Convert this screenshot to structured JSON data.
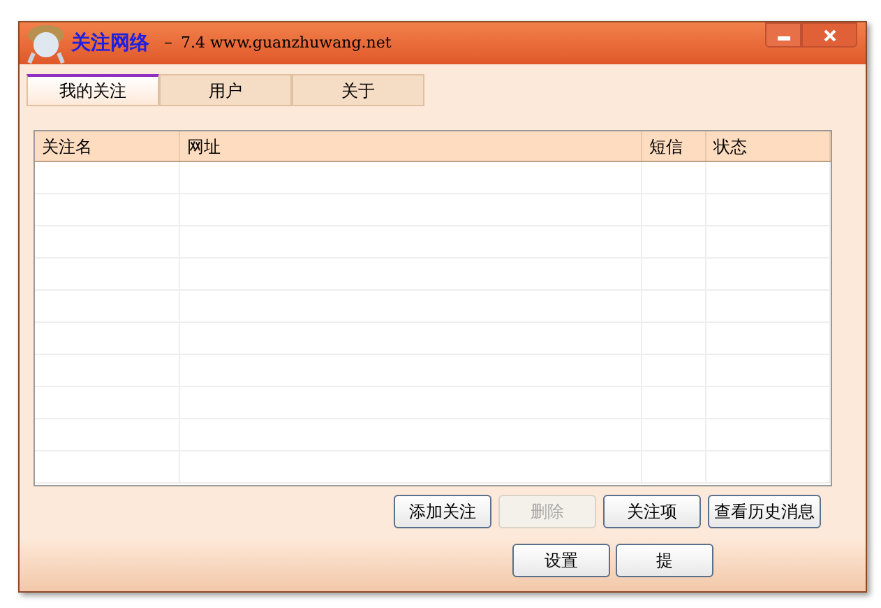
{
  "window": {
    "title": "关注网络",
    "subtitle": "－ 7.4 www.guanzhuwang.net"
  },
  "tabs": [
    {
      "label": "我的关注",
      "selected": true
    },
    {
      "label": "用户",
      "selected": false
    },
    {
      "label": "关于",
      "selected": false
    }
  ],
  "table": {
    "columns": [
      "关注名",
      "网址",
      "短信",
      "状态"
    ]
  },
  "buttons": [
    {
      "label": "添加关注",
      "disabled": false
    },
    {
      "label": "删除",
      "disabled": true
    },
    {
      "label": "关注项",
      "disabled": false
    },
    {
      "label": "查看历史消息",
      "disabled": false
    }
  ],
  "footer_buttons": [
    {
      "label": "设置",
      "disabled": false
    },
    {
      "label": "提",
      "disabled": false
    }
  ]
}
